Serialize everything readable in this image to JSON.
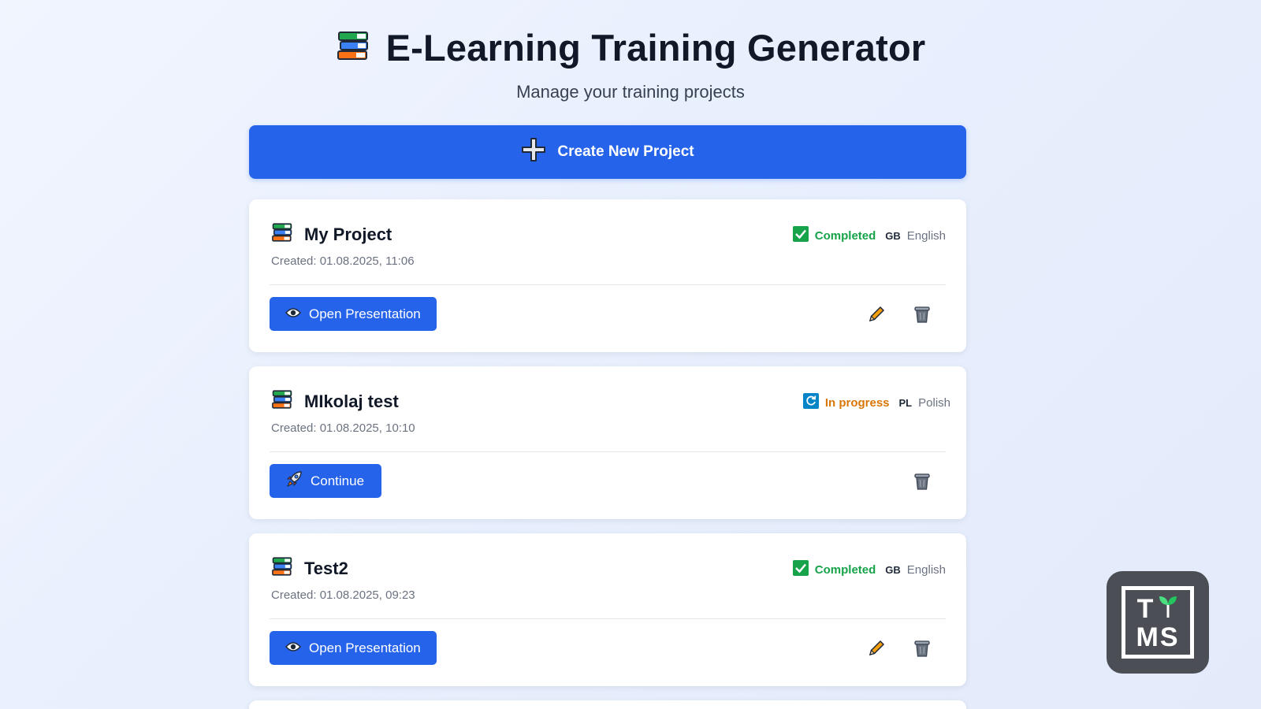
{
  "header": {
    "title": "E-Learning Training Generator",
    "subtitle": "Manage your training projects",
    "icon": "books-icon"
  },
  "create_button": {
    "label": "Create New Project",
    "icon": "plus-icon"
  },
  "projects": [
    {
      "name": "My Project",
      "created": "Created: 01.08.2025, 11:06",
      "status": "Completed",
      "status_icon": "check-icon",
      "lang_code": "GB",
      "lang_name": "English",
      "action_label": "Open Presentation",
      "action_icon": "eye-icon",
      "can_edit": true
    },
    {
      "name": "MIkolaj test",
      "created": "Created: 01.08.2025, 10:10",
      "status": "In progress",
      "status_icon": "refresh-icon",
      "lang_code": "PL",
      "lang_name": "Polish",
      "action_label": "Continue",
      "action_icon": "rocket-icon",
      "can_edit": false
    },
    {
      "name": "Test2",
      "created": "Created: 01.08.2025, 09:23",
      "status": "Completed",
      "status_icon": "check-icon",
      "lang_code": "GB",
      "lang_name": "English",
      "action_label": "Open Presentation",
      "action_icon": "eye-icon",
      "can_edit": true
    }
  ],
  "logo": {
    "line1": "T",
    "line2": "MS"
  },
  "colors": {
    "primary": "#2563eb",
    "completed": "#16a34a",
    "in_progress": "#d97706"
  }
}
